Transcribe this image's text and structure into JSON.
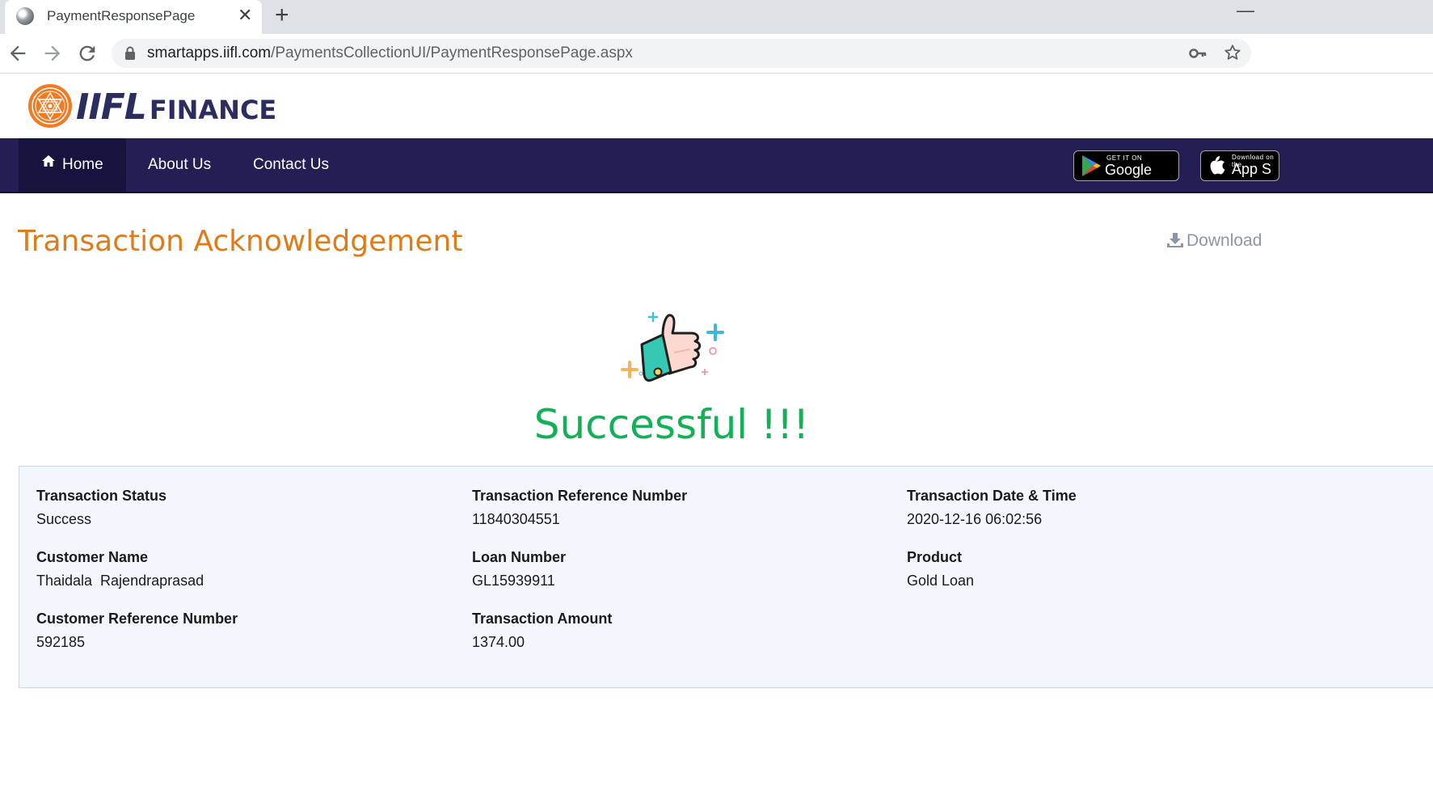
{
  "browser": {
    "tab_title": "PaymentResponsePage",
    "url_host": "smartapps.iifl.com",
    "url_path": "/PaymentsCollectionUI/PaymentResponsePage.aspx"
  },
  "brand": {
    "logo_iifl": "IIFL",
    "logo_finance": "FINANCE",
    "primary_color": "#231f54",
    "accent_color": "#e07b1a",
    "success_color": "#13b157"
  },
  "nav": {
    "items": [
      {
        "label": "Home",
        "icon": "home-icon",
        "active": true
      },
      {
        "label": "About Us"
      },
      {
        "label": "Contact Us"
      }
    ],
    "google_play": {
      "small": "GET IT ON",
      "big": "Google Play"
    },
    "app_store": {
      "small": "Download on the",
      "big": "App S"
    }
  },
  "page": {
    "title": "Transaction Acknowledgement",
    "download_label": "Download",
    "success_message": "Successful !!!"
  },
  "details": [
    {
      "label": "Transaction Status",
      "value": "Success"
    },
    {
      "label": "Transaction Reference Number",
      "value": "11840304551"
    },
    {
      "label": "Transaction Date & Time",
      "value": "2020-12-16 06:02:56"
    },
    {
      "label": "Customer Name",
      "value": "Thaidala  Rajendraprasad"
    },
    {
      "label": "Loan Number",
      "value": "GL15939911"
    },
    {
      "label": "Product",
      "value": "Gold Loan"
    },
    {
      "label": "Customer Reference Number",
      "value": "592185"
    },
    {
      "label": "Transaction Amount",
      "value": "1374.00"
    }
  ]
}
